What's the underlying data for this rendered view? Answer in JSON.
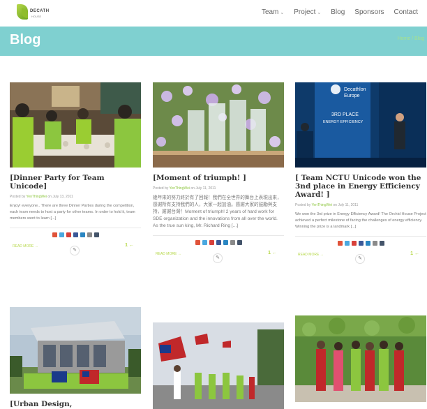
{
  "brand": {
    "name": "DECATH",
    "subtitle": "HOUSE"
  },
  "nav": {
    "items": [
      {
        "label": "Team",
        "dropdown": true
      },
      {
        "label": "Project",
        "dropdown": true
      },
      {
        "label": "Blog",
        "dropdown": false
      },
      {
        "label": "Sponsors",
        "dropdown": false
      },
      {
        "label": "Contact",
        "dropdown": false
      }
    ]
  },
  "banner": {
    "title": "Blog",
    "breadcrumb": "Home / Blog"
  },
  "share_icons": [
    {
      "name": "pinterest-icon",
      "color": "#e0533a"
    },
    {
      "name": "twitter-icon",
      "color": "#4aa8e0"
    },
    {
      "name": "google-plus-icon",
      "color": "#d8403a"
    },
    {
      "name": "facebook-icon",
      "color": "#3b5998"
    },
    {
      "name": "linkedin-icon",
      "color": "#2a86c2"
    },
    {
      "name": "email-icon",
      "color": "#8a8a8a"
    },
    {
      "name": "tumblr-icon",
      "color": "#44546a"
    }
  ],
  "posts": [
    {
      "title": "[Dinner Party for Team Unicode]",
      "meta_prefix": "Posted by ",
      "author": "YenThingWei",
      "date": " on July 13, 2011",
      "excerpt": "Enjoy! everyone.. There are three Dinner Parties during the competition, each team needs to host a party for other teams. In order to hold it, team members went to learn [...]",
      "read_more": "READ MORE →",
      "count": "1 ←",
      "image": "dinner"
    },
    {
      "title": "[Moment of triumph! ]",
      "meta_prefix": "Posted by ",
      "author": "YenThingWei",
      "date": " on July 11, 2011",
      "excerpt": "幾年來的努力終於有了回報！我們在全世界的舞台上表現出來，感謝所有支持我們的人，大家一起加油。感謝大家的鼓勵與支持，謝謝台灣！Moment of triumph! 2 years of hard work for SDE organization and the innovations from all over the world. As the true sun king, Mr. Richard Ring [...]",
      "read_more": "READ MORE →",
      "count": "1 ←",
      "image": "trophies"
    },
    {
      "title": "[ Team NCTU Unicode won the 3nd place in Energy Efficiency Award! ]",
      "meta_prefix": "Posted by ",
      "author": "YenThingWei",
      "date": " on July 11, 2011",
      "excerpt": "We won the 3rd prize in Energy Efficiency Award! The Orchid House Project achieved a perfect milestone of facing the challenges of energy efficiency. Winning the prize is a landmark [...]",
      "read_more": "READ MORE →",
      "count": "1 ←",
      "image": "award",
      "award_lines": [
        "Decathlon",
        "Europe",
        "3RD PLACE",
        "ENERGY EFFICIENCY"
      ]
    },
    {
      "title": "[Urban Design,",
      "image": "house"
    },
    {
      "title": "",
      "image": "flags"
    },
    {
      "title": "",
      "image": "greenwall"
    }
  ]
}
